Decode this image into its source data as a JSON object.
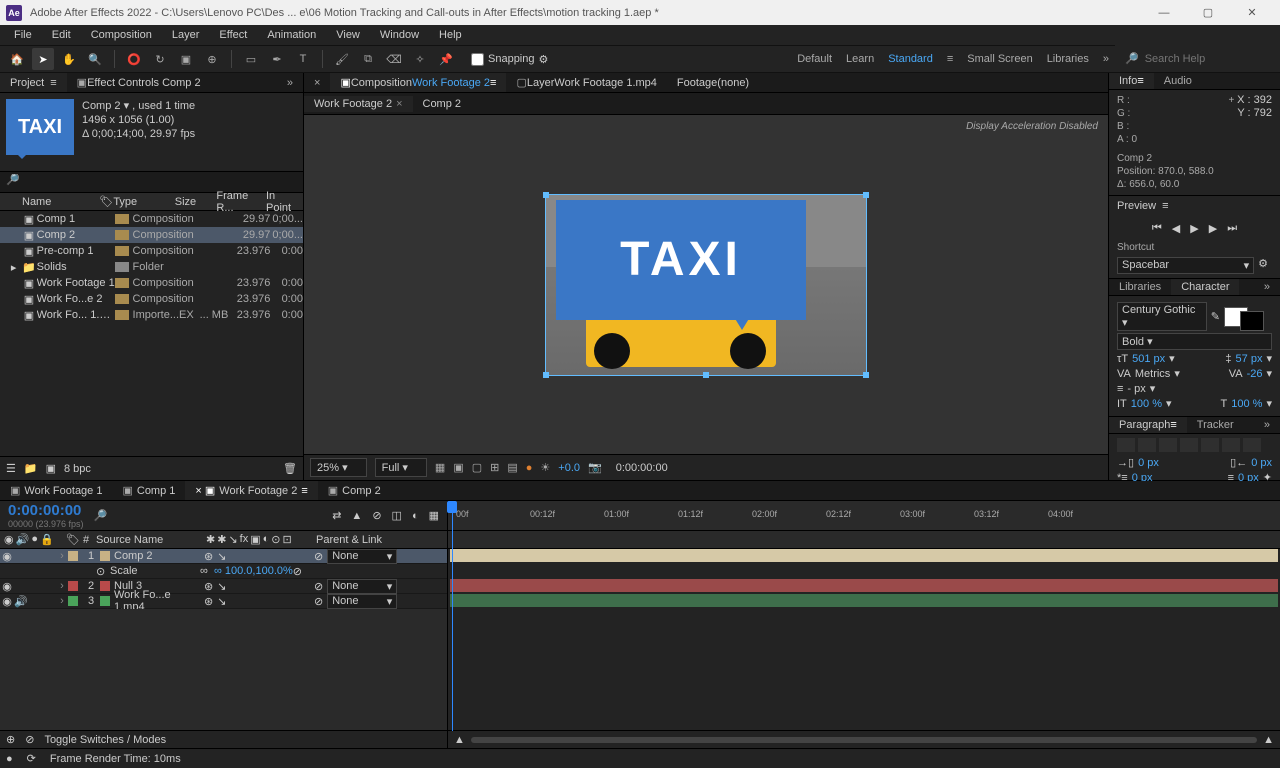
{
  "titlebar": {
    "app_logo": "Ae",
    "title": "Adobe After Effects 2022 - C:\\Users\\Lenovo PC\\Des ... e\\06 Motion Tracking and Call-outs in After Effects\\motion tracking 1.aep *"
  },
  "menubar": [
    "File",
    "Edit",
    "Composition",
    "Layer",
    "Effect",
    "Animation",
    "View",
    "Window",
    "Help"
  ],
  "toolbar": {
    "snapping_label": "Snapping",
    "workspaces": [
      "Default",
      "Learn",
      "Standard",
      "Small Screen",
      "Libraries"
    ],
    "active_workspace": "Standard",
    "search_placeholder": "Search Help"
  },
  "left_panel": {
    "tabs": [
      "Project",
      "Effect Controls Comp 2"
    ],
    "taxi_text": "TAXI",
    "info_name": "Comp 2 ▾ , used 1 time",
    "info_dim": "1496 x 1056 (1.00)",
    "info_dur": "Δ 0;00;14;00, 29.97 fps",
    "headers": {
      "name": "Name",
      "type": "Type",
      "size": "Size",
      "fps": "Frame R...",
      "in": "In Point"
    },
    "items": [
      {
        "name": "Comp 1",
        "type": "Composition",
        "size": "",
        "fps": "29.97",
        "in": "0;00..."
      },
      {
        "name": "Comp 2",
        "type": "Composition",
        "size": "",
        "fps": "29.97",
        "in": "0;00...",
        "sel": true
      },
      {
        "name": "Pre-comp 1",
        "type": "Composition",
        "size": "",
        "fps": "23.976",
        "in": "0:00"
      },
      {
        "name": "Solids",
        "type": "Folder",
        "size": "",
        "fps": "",
        "in": ""
      },
      {
        "name": "Work Footage 1",
        "type": "Composition",
        "size": "",
        "fps": "23.976",
        "in": "0:00"
      },
      {
        "name": "Work Fo...e 2",
        "type": "Composition",
        "size": "",
        "fps": "23.976",
        "in": "0:00"
      },
      {
        "name": "Work Fo... 1.mp4",
        "type": "Importe...EX",
        "size": "... MB",
        "fps": "23.976",
        "in": "0:00"
      }
    ],
    "footer_bpc": "8 bpc"
  },
  "center": {
    "tabs": {
      "composition": "Composition",
      "comp_title": "Work Footage 2",
      "layer": "Layer",
      "layer_title": "Work Footage 1.mp4",
      "footage": "Footage",
      "footage_val": "(none)"
    },
    "subtabs": [
      "Work Footage 2",
      "Comp 2"
    ],
    "disp_accel": "Display Acceleration Disabled",
    "taxi": "TAXI",
    "zoom": "25%",
    "res": "Full",
    "exposure": "+0.0",
    "time": "0:00:00:00"
  },
  "right": {
    "info": {
      "title": "Info",
      "tab2": "Audio",
      "rgb": {
        "r": "R :",
        "g": "G :",
        "b": "B :",
        "a": "A : 0"
      },
      "x": "X : 392",
      "y": "Y : 792",
      "comp": "Comp 2",
      "pos": "Position: 870.0, 588.0",
      "delta": "Δ: 656.0, 60.0"
    },
    "preview": {
      "title": "Preview"
    },
    "shortcut": {
      "title": "Shortcut",
      "value": "Spacebar"
    },
    "libchar": {
      "lib": "Libraries",
      "char": "Character"
    },
    "character": {
      "font": "Century Gothic",
      "style": "Bold",
      "size": "501 px",
      "leading": "57 px",
      "kerning": "Metrics",
      "tracking": "-26",
      "px_dash": "- px",
      "scale_h": "100 %",
      "scale_v": "100 %"
    },
    "para": {
      "title": "Paragraph",
      "tracker": "Tracker",
      "indent": "0 px"
    }
  },
  "timeline": {
    "tabs": [
      "Work Footage 1",
      "Comp 1",
      "Work Footage 2",
      "Comp 2"
    ],
    "active_tab": 2,
    "timecode": "0:00:00:00",
    "timecode_sub": "00000 (23.976 fps)",
    "cols": {
      "source_name": "Source Name",
      "parent": "Parent & Link"
    },
    "layers": [
      {
        "n": "1",
        "name": "Comp 2",
        "parent": "None",
        "sel": true,
        "color": "#c7b185"
      },
      {
        "n": "",
        "name": "Scale",
        "val": "∞ 100.0,100.0%",
        "sub": true
      },
      {
        "n": "2",
        "name": "Null 3",
        "parent": "None",
        "color": "#b84a4a"
      },
      {
        "n": "3",
        "name": "Work Fo...e 1.mp4",
        "parent": "None",
        "color": "#4aa35a"
      }
    ],
    "ruler": [
      "00f",
      "00:12f",
      "01:00f",
      "01:12f",
      "02:00f",
      "02:12f",
      "03:00f",
      "03:12f",
      "04:00f"
    ],
    "footer_switch": "Toggle Switches / Modes"
  },
  "statusbar": {
    "render": "Frame Render Time: 10ms"
  }
}
